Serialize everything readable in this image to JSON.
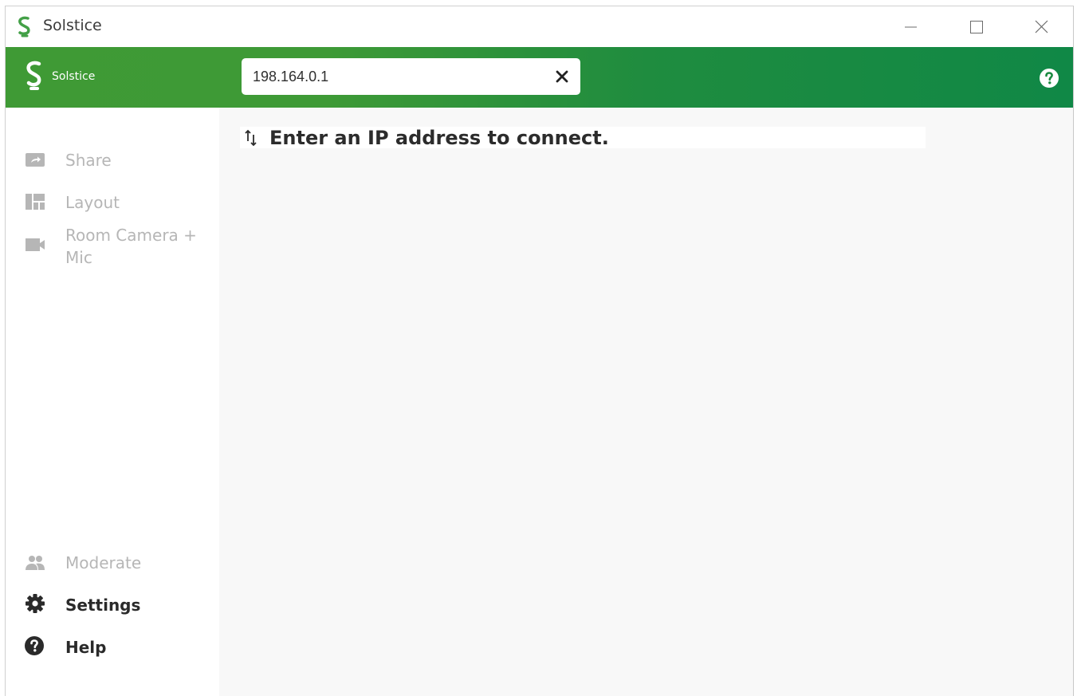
{
  "window": {
    "title": "Solstice"
  },
  "header": {
    "brand": "Solstice",
    "ip_input": {
      "value": "198.164.0.1"
    }
  },
  "sidebar": {
    "items": [
      {
        "label": "Share",
        "icon": "share-icon",
        "enabled": false
      },
      {
        "label": "Layout",
        "icon": "layout-icon",
        "enabled": false
      },
      {
        "label": "Room Camera + Mic",
        "icon": "camera-icon",
        "enabled": false
      },
      {
        "label": "Moderate",
        "icon": "users-icon",
        "enabled": false
      },
      {
        "label": "Settings",
        "icon": "gear-icon",
        "enabled": true
      },
      {
        "label": "Help",
        "icon": "help-icon",
        "enabled": true
      }
    ]
  },
  "main": {
    "status_text": "Enter an IP address to connect."
  },
  "colors": {
    "brand_green_left": "#3f9a35",
    "brand_green_right": "#108846",
    "disabled_text": "#b6b6b6"
  }
}
